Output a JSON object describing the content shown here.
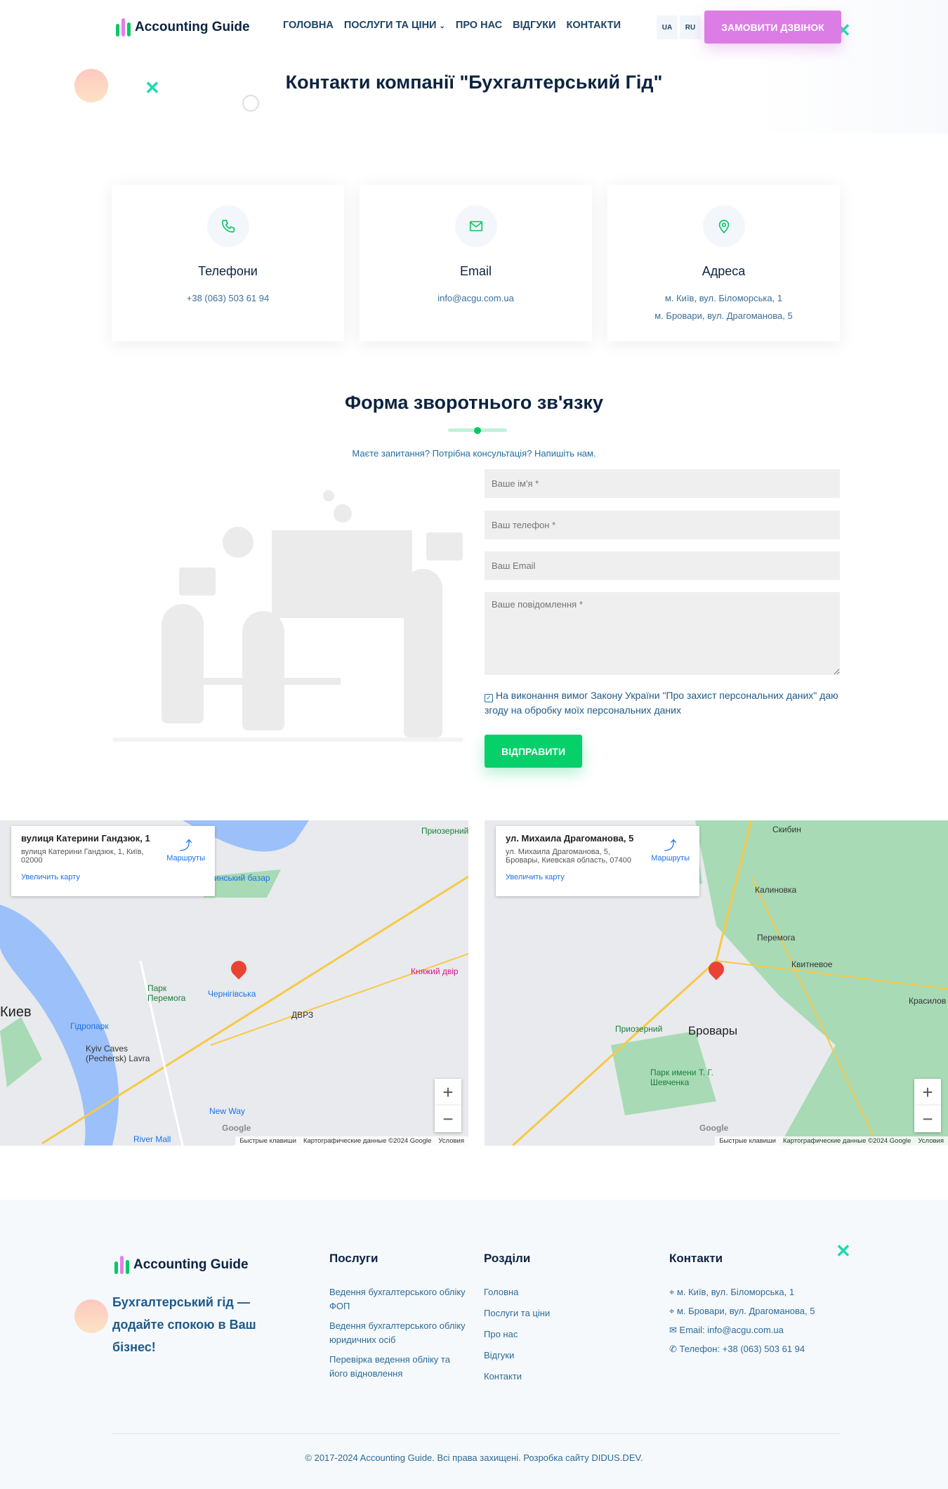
{
  "header": {
    "logo": "Accounting Guide",
    "nav": [
      "ГОЛОВНА",
      "ПОСЛУГИ ТА ЦІНИ",
      "ПРО НАС",
      "ВІДГУКИ",
      "КОНТАКТИ"
    ],
    "langs": [
      "UA",
      "RU"
    ],
    "call_button": "ЗАМОВИТИ ДЗВІНОК"
  },
  "page_title": "Контакти компанії \"Бухгалтерський Гід\"",
  "cards": [
    {
      "icon": "phone-icon",
      "title": "Телефони",
      "lines": [
        "+38 (063) 503 61 94"
      ]
    },
    {
      "icon": "mail-icon",
      "title": "Email",
      "lines": [
        "info@acgu.com.ua"
      ]
    },
    {
      "icon": "location-icon",
      "title": "Адреса",
      "lines": [
        "м. Київ, вул. Біломорська, 1",
        "м. Бровари, вул. Драгоманова, 5"
      ]
    }
  ],
  "form": {
    "title": "Форма зворотнього зв'язку",
    "subtitle": "Маєте запитання? Потрібна консультація? Напишіть нам.",
    "name_ph": "Ваше ім'я *",
    "phone_ph": "Ваш телефон *",
    "email_ph": "Ваш Email",
    "message_ph": "Ваше повідомлення *",
    "consent": "На виконання вимог Закону України \"Про захист персональних даних\" даю згоду на обробку моїх персональних даних",
    "consent_checked": true,
    "submit": "ВІДПРАВИТИ"
  },
  "maps": [
    {
      "title": "вулиця Катерини Гандзюк, 1",
      "address": "вулиця Катерини Гандзюк, 1, Київ, 02000",
      "routes": "Маршруты",
      "enlarge": "Увеличить карту",
      "labels": [
        "Приозерний",
        "инський базар",
        "Парк Перемога",
        "Чернігівська",
        "ДВРЗ",
        "Киев",
        "Гідропарк",
        "Kyiv Caves (Pechersk) Lavra",
        "Княжий двір",
        "New Way",
        "River Mall",
        "Google"
      ],
      "attribution": [
        "Быстрые клавиши",
        "Картографические данные ©2024 Google",
        "Условия"
      ]
    },
    {
      "title": "ул. Михаила Драгоманова, 5",
      "address": "ул. Михаила Драгоманова, 5, Бровары, Киевская область, 07400",
      "routes": "Маршруты",
      "enlarge": "Увеличить карту",
      "labels": [
        "Скибин",
        "Калиновка",
        "Перемога",
        "Квитневое",
        "Бровары",
        "Приозерний",
        "Парк имени Т. Г. Шевченка",
        "Красилов",
        "Google"
      ],
      "attribution": [
        "Быстрые клавиши",
        "Картографические данные ©2024 Google",
        "Условия"
      ]
    }
  ],
  "footer": {
    "logo": "Accounting Guide",
    "slogan": "Бухгалтерський гід — додайте спокою в Ваш бізнес!",
    "services_title": "Послуги",
    "services": [
      "Ведення бухгалтерського обліку ФОП",
      "Ведення бухгалтерського обліку юридичних осіб",
      "Перевірка ведення обліку та його відновлення"
    ],
    "sections_title": "Розділи",
    "sections": [
      "Головна",
      "Послуги та ціни",
      "Про нас",
      "Відгуки",
      "Контакти"
    ],
    "contacts_title": "Контакти",
    "contacts": [
      "м. Київ, вул. Біломорська, 1",
      "м. Бровари, вул. Драгоманова, 5",
      "Email: info@acgu.com.ua",
      "Телефон: +38 (063) 503 61 94"
    ],
    "copyright": "© 2017-2024 Accounting Guide. Всі права захищені. Розробка сайту DIDUS.DEV."
  },
  "colors": {
    "accent_green": "#06d06a",
    "call_pink": "#dc7de6",
    "navy": "#0c2340",
    "link_blue": "#2d6a96"
  }
}
